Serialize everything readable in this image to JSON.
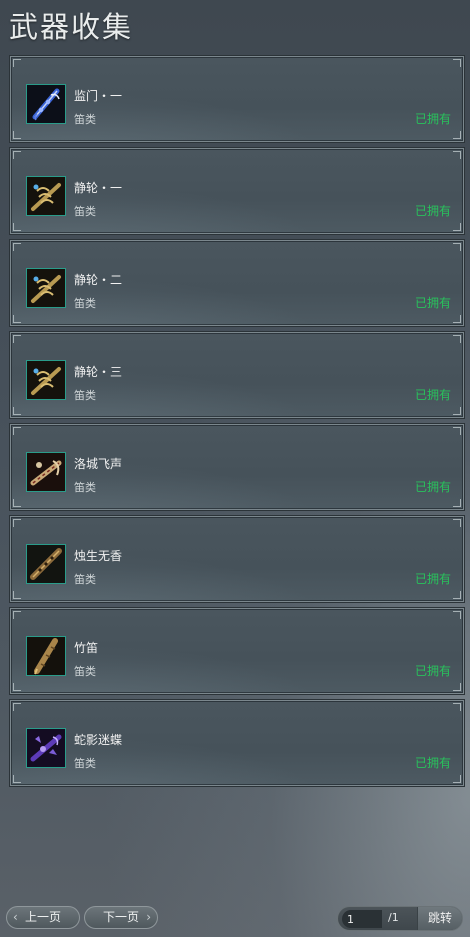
{
  "title": "武器收集",
  "weapons": [
    {
      "name": "监门・一",
      "category": "笛类",
      "status": "已拥有",
      "icon": "blue-silver-flute-icon"
    },
    {
      "name": "静轮・一",
      "category": "笛类",
      "status": "已拥有",
      "icon": "golden-claw-flute-icon"
    },
    {
      "name": "静轮・二",
      "category": "笛类",
      "status": "已拥有",
      "icon": "golden-claw-flute-icon"
    },
    {
      "name": "静轮・三",
      "category": "笛类",
      "status": "已拥有",
      "icon": "golden-claw-flute-icon"
    },
    {
      "name": "洛城飞声",
      "category": "笛类",
      "status": "已拥有",
      "icon": "red-tassel-flute-icon"
    },
    {
      "name": "烛生无香",
      "category": "笛类",
      "status": "已拥有",
      "icon": "bronze-flute-icon"
    },
    {
      "name": "竹笛",
      "category": "笛类",
      "status": "已拥有",
      "icon": "bamboo-flute-icon"
    },
    {
      "name": "蛇影迷蝶",
      "category": "笛类",
      "status": "已拥有",
      "icon": "purple-serpent-flute-icon"
    }
  ],
  "pagination": {
    "prev_label": "上一页",
    "next_label": "下一页",
    "current_page": "1",
    "total_pages": "/1",
    "jump_label": "跳转"
  },
  "colors": {
    "owned_status": "#29c25c",
    "icon_border": "#2a9c8a"
  }
}
